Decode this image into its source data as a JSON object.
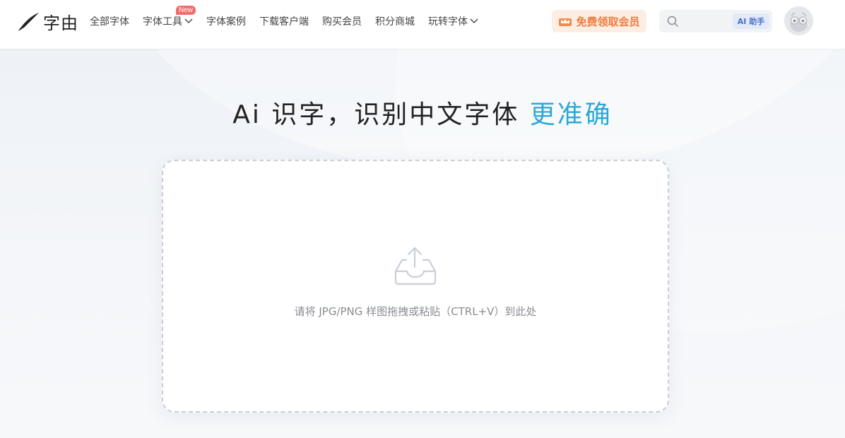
{
  "header": {
    "logo_text": "字由",
    "nav": [
      {
        "label": "全部字体"
      },
      {
        "label": "字体工具",
        "badge": "New",
        "has_dropdown": true
      },
      {
        "label": "字体案例"
      },
      {
        "label": "下载客户端"
      },
      {
        "label": "购买会员"
      },
      {
        "label": "积分商城"
      },
      {
        "label": "玩转字体",
        "has_dropdown": true
      }
    ],
    "vip_button": "免费领取会员",
    "search": {
      "placeholder": "",
      "value": ""
    },
    "ai_button": "AI 助手"
  },
  "main": {
    "headline_prefix": "Ai 识字，识别中文字体 ",
    "headline_accent": "更准确",
    "drop_hint": "请将 JPG/PNG 样图拖拽或粘贴（CTRL+V）到此处"
  },
  "colors": {
    "accent": "#2ba8d4",
    "vip": "#f07b3f",
    "badge": "#f26b6b"
  },
  "icons": [
    "brush-logo-icon",
    "chevron-down-icon",
    "crown-icon",
    "search-icon",
    "avatar-icon",
    "upload-tray-icon"
  ]
}
